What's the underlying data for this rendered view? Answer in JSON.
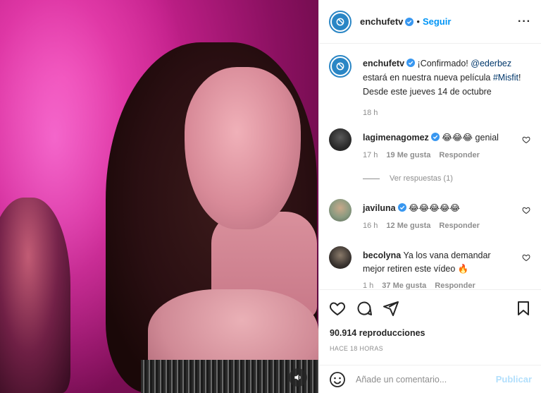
{
  "post": {
    "author": "enchufetv",
    "follow_label": "Seguir",
    "dot": "•",
    "more_label": "···"
  },
  "caption": {
    "username": "enchufetv",
    "text_before": "¡Confirmado! ",
    "mention": "@ederbez",
    "text_mid": " estará en nuestra nueva película ",
    "hashtag": "#Misfit",
    "text_after": "! Desde este jueves 14 de octubre",
    "time": "18 h"
  },
  "comments": [
    {
      "username": "lagimenagomez",
      "verified": true,
      "text": "😂😂😂 genial",
      "time": "17 h",
      "likes": "19 Me gusta",
      "reply": "Responder",
      "avatar_color": "#2b2b2b"
    },
    {
      "username": "javiluna",
      "verified": true,
      "text": "😂😂😂😂😂",
      "time": "16 h",
      "likes": "12 Me gusta",
      "reply": "Responder",
      "avatar_color": "#7a8a70"
    },
    {
      "username": "becolyna",
      "verified": false,
      "text": "Ya los vana demandar mejor retiren este vídeo 🔥",
      "time": "1 h",
      "likes": "37 Me gusta",
      "reply": "Responder",
      "avatar_color": "#3a3430"
    }
  ],
  "view_replies": "Ver respuestas (1)",
  "stats": {
    "views": "90.914 reproducciones",
    "ago": "HACE 18 HORAS"
  },
  "add_comment": {
    "placeholder": "Añade un comentario...",
    "publish": "Publicar"
  },
  "colors": {
    "brand_blue": "#2a86c5",
    "link": "#00376b",
    "follow": "#0095f6",
    "muted": "#8e8e8e",
    "publish_disabled": "#b2dffc"
  },
  "icons": {
    "like": "heart-icon",
    "comment": "comment-icon",
    "share": "share-icon",
    "save": "bookmark-icon",
    "emoji": "emoji-icon",
    "more": "more-options-icon",
    "sound": "speaker-icon",
    "verified": "verified-badge-icon"
  }
}
